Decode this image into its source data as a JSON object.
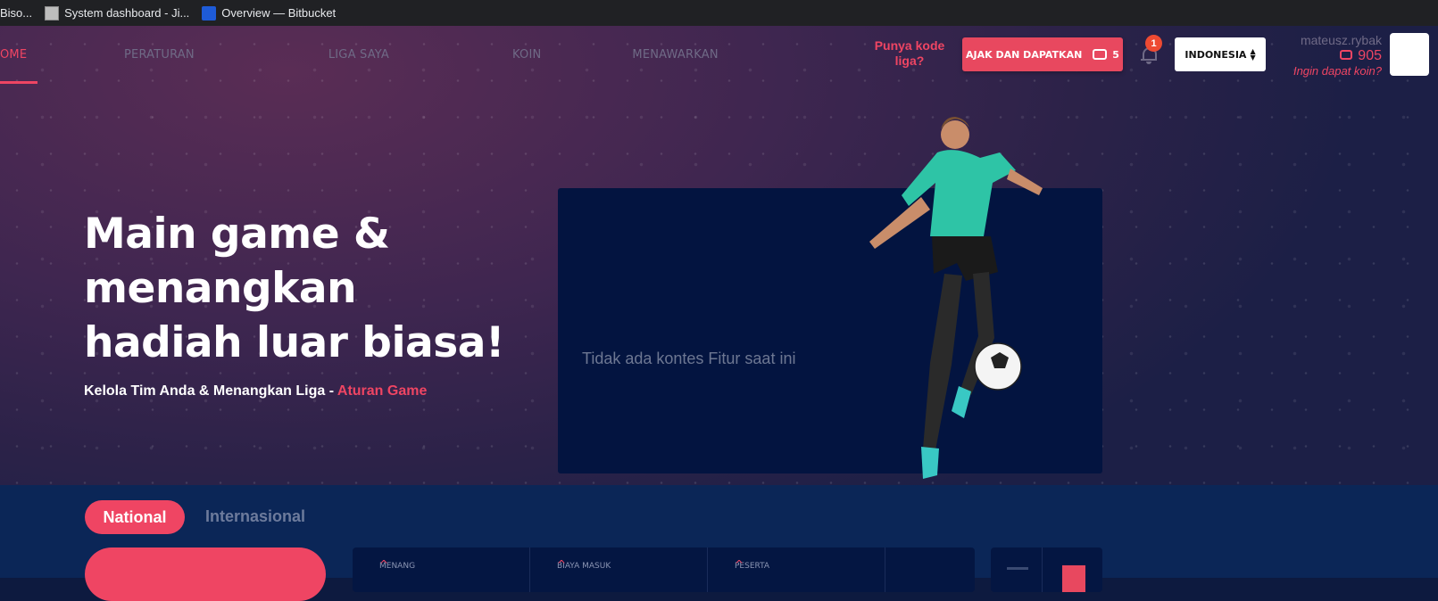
{
  "bookmarks": [
    {
      "label": "Biso...",
      "icon": "none"
    },
    {
      "label": "System dashboard - Ji...",
      "icon": "jira-page-icon"
    },
    {
      "label": "Overview — Bitbucket",
      "icon": "bitbucket-icon"
    }
  ],
  "nav": {
    "home": "OME",
    "peraturan": "PERATURAN",
    "liga_saya": "LIGA SAYA",
    "koin": "KOIN",
    "menawarkan": "MENAWARKAN"
  },
  "header": {
    "promo_question": "Punya kode liga?",
    "invite_label": "AJAK DAN DAPATKAN",
    "invite_coins": "5",
    "notification_count": "1",
    "language": "INDONESIA",
    "username": "mateusz.rybak",
    "coin_balance": "905",
    "want_coins": "Ingin dapat koin?"
  },
  "hero": {
    "headline": "Main game & menangkan hadiah luar biasa!",
    "subline": "Kelola Tim Anda & Menangkan Liga - ",
    "rules_link": "Aturan Game",
    "featured_empty": "Tidak ada kontes Fitur saat ini"
  },
  "contests": {
    "tab_national": "National",
    "tab_international": "Internasional",
    "columns": [
      "MENANG",
      "BIAYA MASUK",
      "PESERTA"
    ]
  },
  "colors": {
    "accent": "#ef4563",
    "navy": "#031440"
  }
}
